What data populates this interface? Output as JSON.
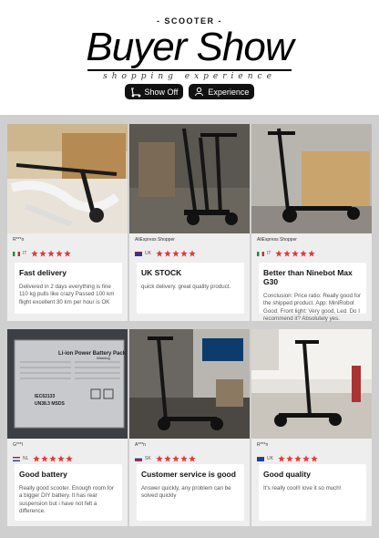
{
  "header": {
    "kicker": "- SCOOTER -",
    "title": "Buyer Show",
    "subtitle": "shopping experience",
    "buttons": [
      {
        "label": "Show Off",
        "icon": "scooter-icon"
      },
      {
        "label": "Experience",
        "icon": "person-icon"
      }
    ]
  },
  "colors": {
    "accent": "#e23a3a",
    "dark": "#111111",
    "card": "#eeeeee"
  },
  "reviews": [
    {
      "user": "R***o",
      "country": "IT",
      "stars": 5,
      "headline": "Fast delivery",
      "body": "Delivered in 2 days everything is fine 110 kg pulls like crazy Passed 100 km flight excellent 30 km per hour is OK"
    },
    {
      "user": "AliExpress Shopper",
      "country": "UK",
      "stars": 5,
      "headline": "UK STOCK",
      "body": "quick delivery. great quality product."
    },
    {
      "user": "AliExpress Shopper",
      "country": "IT",
      "stars": 5,
      "headline": "Better than Ninebot Max G30",
      "body": "Conclusion: Price ratio: Really good for the shipped product. App: MiniRobot Good. Front light: Very good, Led. Do I recommend it? Absolutely yes."
    },
    {
      "user": "G***l",
      "country": "NL",
      "stars": 5,
      "headline": "Good battery",
      "body": "Really good scooter. Enough room for a bigger DIY battery. It has rear suspension but i have not felt a difference."
    },
    {
      "user": "A***n",
      "country": "SK",
      "stars": 5,
      "headline": "Customer service is good",
      "body": "Answer quickly, any problem can be solved quickly"
    },
    {
      "user": "R***n",
      "country": "UK",
      "stars": 5,
      "headline": "Good quality",
      "body": "It's really cool!I love it so much!"
    }
  ],
  "battery_label": {
    "title": "Li-ion Power Battery Pack",
    "spec": "IEC62133",
    "spec2": "UN38.3 MSDS",
    "warning": "Warning"
  }
}
